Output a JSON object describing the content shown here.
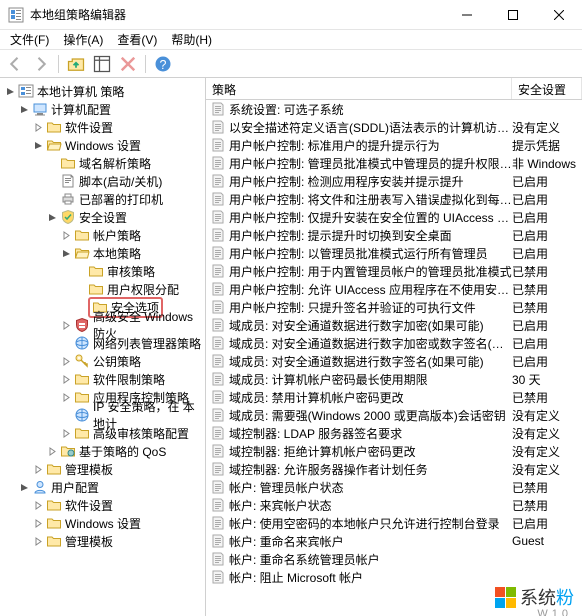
{
  "window": {
    "title": "本地组策略编辑器"
  },
  "menu": {
    "file": "文件(F)",
    "action": "操作(A)",
    "view": "查看(V)",
    "help": "帮助(H)"
  },
  "tree": {
    "root": "本地计算机 策略",
    "computer_config": "计算机配置",
    "software_settings": "软件设置",
    "windows_settings": "Windows 设置",
    "name_resolution": "域名解析策略",
    "scripts": "脚本(启动/关机)",
    "deployed_printers": "已部署的打印机",
    "security_settings": "安全设置",
    "account_policies": "帐户策略",
    "local_policies": "本地策略",
    "audit_policy": "审核策略",
    "user_rights": "用户权限分配",
    "security_options": "安全选项",
    "advanced_firewall": "高级安全 Windows 防火",
    "network_list": "网络列表管理器策略",
    "public_key": "公钥策略",
    "software_restriction": "软件限制策略",
    "app_control": "应用程序控制策略",
    "ip_security": "IP 安全策略，在 本地计",
    "advanced_audit": "高级审核策略配置",
    "qos": "基于策略的 QoS",
    "admin_templates": "管理模板",
    "user_config": "用户配置",
    "user_software": "软件设置",
    "user_windows": "Windows 设置",
    "user_templates": "管理模板"
  },
  "list_header": {
    "policy": "策略",
    "setting": "安全设置"
  },
  "policies": [
    {
      "label": "系统设置: 可选子系统",
      "setting": ""
    },
    {
      "label": "以安全描述符定义语言(SDDL)语法表示的计算机访问限制",
      "setting": "没有定义"
    },
    {
      "label": "用户帐户控制: 标准用户的提升提示行为",
      "setting": "提示凭据"
    },
    {
      "label": "用户帐户控制: 管理员批准模式中管理员的提升权限提示的...",
      "setting": "非 Windows"
    },
    {
      "label": "用户帐户控制: 检测应用程序安装并提示提升",
      "setting": "已启用"
    },
    {
      "label": "用户帐户控制: 将文件和注册表写入错误虚拟化到每用户位置",
      "setting": "已启用"
    },
    {
      "label": "用户帐户控制: 仅提升安装在安全位置的 UIAccess 应用程序",
      "setting": "已启用"
    },
    {
      "label": "用户帐户控制: 提示提升时切换到安全桌面",
      "setting": "已启用"
    },
    {
      "label": "用户帐户控制: 以管理员批准模式运行所有管理员",
      "setting": "已启用"
    },
    {
      "label": "用户帐户控制: 用于内置管理员帐户的管理员批准模式",
      "setting": "已禁用"
    },
    {
      "label": "用户帐户控制: 允许 UIAccess 应用程序在不使用安全桌面...",
      "setting": "已禁用"
    },
    {
      "label": "用户帐户控制: 只提升签名并验证的可执行文件",
      "setting": "已禁用"
    },
    {
      "label": "域成员: 对安全通道数据进行数字加密(如果可能)",
      "setting": "已启用"
    },
    {
      "label": "域成员: 对安全通道数据进行数字加密或数字签名(始终)",
      "setting": "已启用"
    },
    {
      "label": "域成员: 对安全通道数据进行数字签名(如果可能)",
      "setting": "已启用"
    },
    {
      "label": "域成员: 计算机帐户密码最长使用期限",
      "setting": "30 天"
    },
    {
      "label": "域成员: 禁用计算机帐户密码更改",
      "setting": "已禁用"
    },
    {
      "label": "域成员: 需要强(Windows 2000 或更高版本)会话密钥",
      "setting": "没有定义"
    },
    {
      "label": "域控制器: LDAP 服务器签名要求",
      "setting": "没有定义"
    },
    {
      "label": "域控制器: 拒绝计算机帐户密码更改",
      "setting": "没有定义"
    },
    {
      "label": "域控制器: 允许服务器操作者计划任务",
      "setting": "没有定义"
    },
    {
      "label": "帐户: 管理员帐户状态",
      "setting": "已禁用"
    },
    {
      "label": "帐户: 来宾帐户状态",
      "setting": "已禁用"
    },
    {
      "label": "帐户: 使用空密码的本地帐户只允许进行控制台登录",
      "setting": "已启用"
    },
    {
      "label": "帐户: 重命名来宾帐户",
      "setting": "Guest"
    },
    {
      "label": "帐户: 重命名系统管理员帐户",
      "setting": ""
    },
    {
      "label": "帐户: 阻止 Microsoft 帐户",
      "setting": ""
    }
  ],
  "watermark": {
    "brand": "系统",
    "brand_accent": "粉",
    "sub": "W10"
  }
}
